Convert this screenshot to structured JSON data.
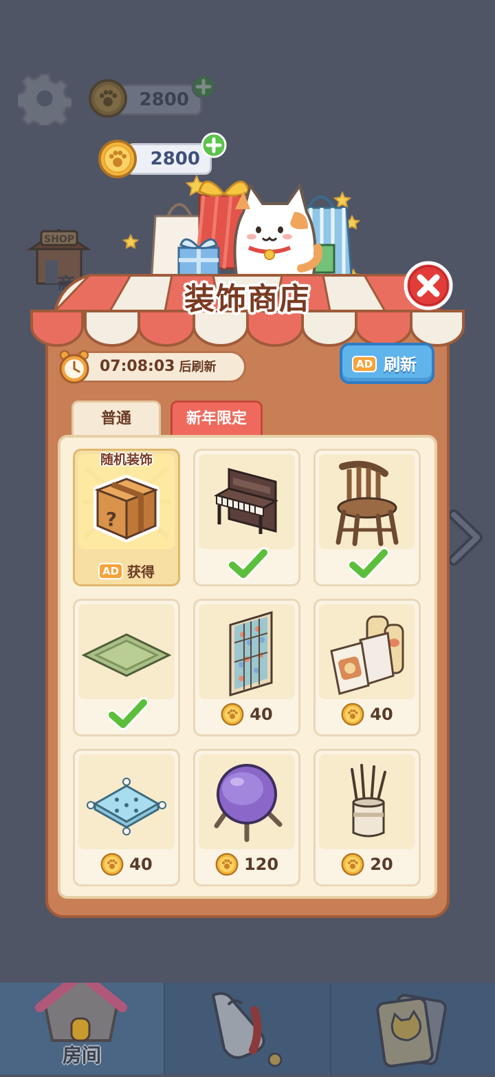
{
  "background": {
    "coin_amount": "2800",
    "shop_sign": "SHOP",
    "shop_label": "商"
  },
  "coins": {
    "amount": "2800"
  },
  "shop": {
    "title": "装饰商店",
    "timer": "07:08:03",
    "timer_suffix": "后刷新",
    "refresh": {
      "ad": "AD",
      "label": "刷新"
    },
    "tabs": [
      {
        "label": "普通",
        "active": false
      },
      {
        "label": "新年限定",
        "active": true
      }
    ],
    "items": [
      {
        "type": "random",
        "label": "随机装饰",
        "ad": "AD",
        "action": "获得",
        "icon": "mystery-box"
      },
      {
        "icon": "piano",
        "owned": true
      },
      {
        "icon": "wooden-chair",
        "owned": true
      },
      {
        "icon": "green-rug",
        "owned": true
      },
      {
        "icon": "stained-glass-window",
        "owned": false,
        "price": "40"
      },
      {
        "icon": "snack-bags",
        "owned": false,
        "price": "40"
      },
      {
        "icon": "blue-cushion",
        "owned": false,
        "price": "40"
      },
      {
        "icon": "purple-ball-chair",
        "owned": false,
        "price": "120"
      },
      {
        "icon": "incense-diffuser",
        "owned": false,
        "price": "20"
      }
    ]
  },
  "nav": {
    "room_label": "房间"
  },
  "colors": {
    "panel": "#c97f56",
    "active_tab": "#ef6a5c",
    "refresh_button": "#5fb4ec",
    "check": "#5bbf3c",
    "coin": "#f2b53a"
  }
}
